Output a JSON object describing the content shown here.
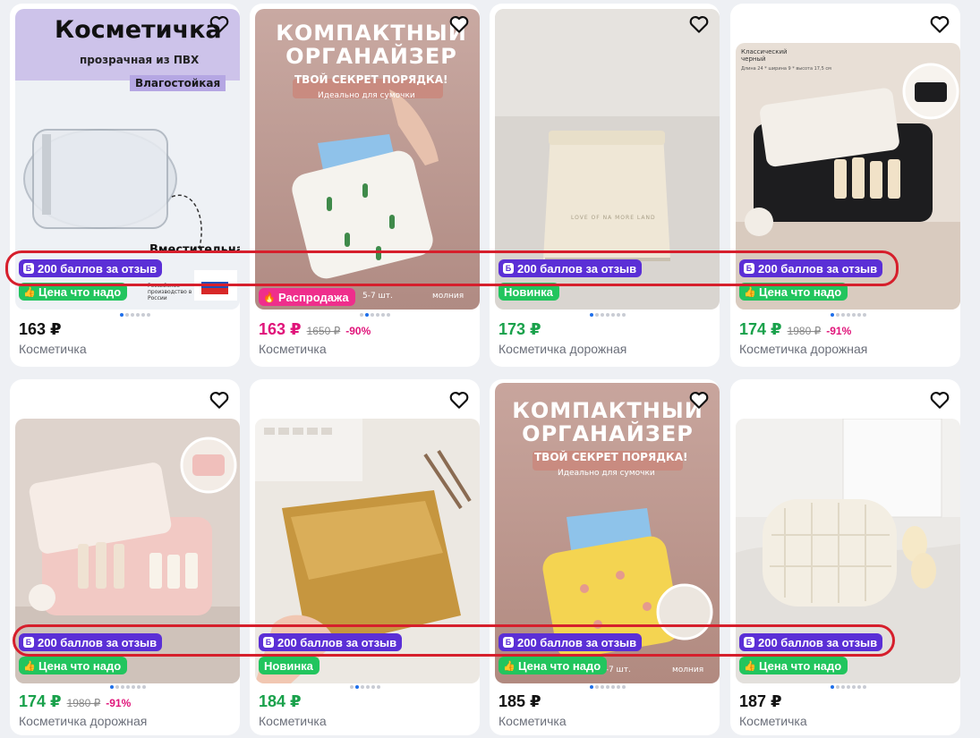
{
  "products": [
    {
      "price": "163 ₽",
      "old_price": "",
      "discount": "",
      "title": "Косметичка",
      "points": "200 баллов за отзыв",
      "tag": "Цена что надо",
      "headline": "Косметичка",
      "subline": "прозрачная из ПВХ",
      "feature": "Влагостойкая",
      "feature2": "Вместительная",
      "madein": "Российское производство в России"
    },
    {
      "price": "163 ₽",
      "old_price": "1650 ₽",
      "discount": "-90%",
      "title": "Косметичка",
      "points": "",
      "tag": "Распродажа",
      "headline": "КОМПАКТНЫЙ ОРГАНАЙЗЕР",
      "subline": "ТВОЙ СЕКРЕТ ПОРЯДКА!",
      "feature": "Идеально для сумочки",
      "stock": "5-7 шт.",
      "extra": "молния"
    },
    {
      "price": "173 ₽",
      "old_price": "",
      "discount": "",
      "title": "Косметичка дорожная",
      "points": "200 баллов за отзыв",
      "tag": "Новинка",
      "pouch_text": "LOVE OF NA MORE LAND"
    },
    {
      "price": "174 ₽",
      "old_price": "1980 ₽",
      "discount": "-91%",
      "title": "Косметичка дорожная",
      "points": "200 баллов за отзыв",
      "tag": "Цена что надо",
      "subline": "Классический черный",
      "feature": "Длина 24 * ширина 9 * высота 17,5 см"
    },
    {
      "price": "174 ₽",
      "old_price": "1980 ₽",
      "discount": "-91%",
      "title": "Косметичка дорожная",
      "points": "200 баллов за отзыв",
      "tag": "Цена что надо"
    },
    {
      "price": "184 ₽",
      "old_price": "",
      "discount": "",
      "title": "Косметичка",
      "points": "200 баллов за отзыв",
      "tag": "Новинка"
    },
    {
      "price": "185 ₽",
      "old_price": "",
      "discount": "",
      "title": "Косметичка",
      "points": "200 баллов за отзыв",
      "tag": "Цена что надо",
      "headline": "КОМПАКТНЫЙ ОРГАНАЙЗЕР",
      "subline": "ТВОЙ СЕКРЕТ ПОРЯДКА!",
      "feature": "Идеально для сумочки",
      "stock": "5-7 шт.",
      "extra": "молния"
    },
    {
      "price": "187 ₽",
      "old_price": "",
      "discount": "",
      "title": "Косметичка",
      "points": "200 баллов за отзыв",
      "tag": "Цена что надо"
    }
  ],
  "points_icon": "Б",
  "colors": {
    "points_badge": "#5b2fd6",
    "tag_green": "#22c55e",
    "tag_pink": "#ef2e8c",
    "sale_price": "#e0147a",
    "green_price": "#19a14b",
    "highlight": "#d61f2c"
  },
  "icons": {
    "heart": "heart-outline-icon",
    "thumb": "thumbs-up-icon",
    "fire": "fire-icon"
  }
}
